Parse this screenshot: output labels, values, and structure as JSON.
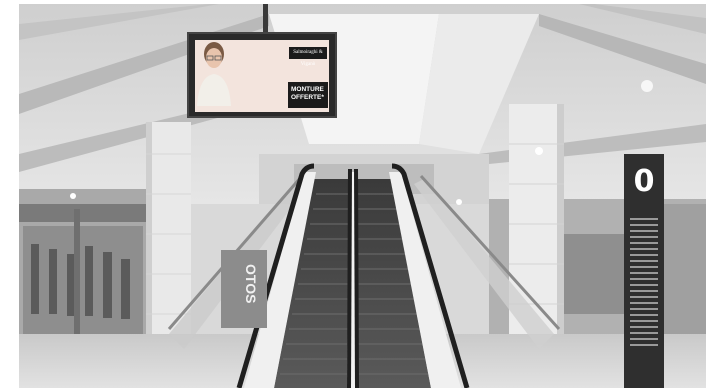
{
  "scene": {
    "kind": "escalator-in-shopping-mall",
    "palette": "grayscale",
    "billboard": {
      "brand": "Salmoiraghi & Viganò",
      "tagline": "",
      "subtitle": "",
      "offer_line1": "MONTURE",
      "offer_line2": "OFFERTE*"
    },
    "pillar_sign": {
      "level": "0"
    },
    "side_sign": {
      "text": "OTOS"
    }
  }
}
